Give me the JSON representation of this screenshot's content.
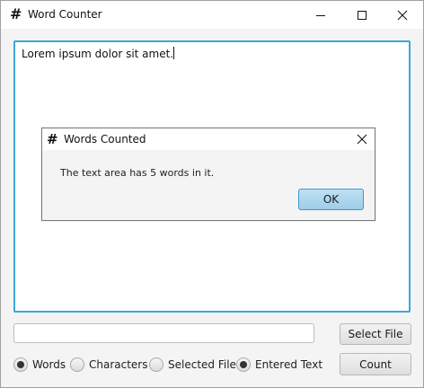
{
  "window": {
    "title": "Word Counter",
    "icon": "hash-icon",
    "controls": [
      "minimize-icon",
      "maximize-icon",
      "close-icon"
    ]
  },
  "text_area": {
    "content": "Lorem ipsum dolor sit amet."
  },
  "dialog": {
    "title": "Words Counted",
    "icon": "hash-icon",
    "message": "The text area has 5 words in it.",
    "ok_label": "OK"
  },
  "file": {
    "path_value": "",
    "select_label": "Select File"
  },
  "options": {
    "words": "Words",
    "characters": "Characters",
    "separator": "|",
    "selected_file": "Selected File",
    "entered_text": "Entered Text",
    "unit_selected": "Words",
    "source_selected": "Entered Text"
  },
  "actions": {
    "count_label": "Count"
  },
  "colors": {
    "focus_border": "#3aa7d6",
    "default_button": "#a7d3ec"
  }
}
